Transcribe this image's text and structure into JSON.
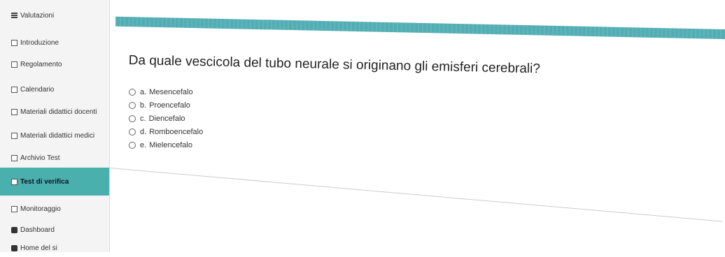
{
  "sidebar": {
    "items": [
      {
        "label": "Valutazioni",
        "icon": "grid-icon",
        "active": false
      },
      {
        "label": "Introduzione",
        "icon": "page-icon",
        "active": false
      },
      {
        "label": "Regolamento",
        "icon": "page-icon",
        "active": false
      },
      {
        "label": "Calendario",
        "icon": "page-icon",
        "active": false
      },
      {
        "label": "Materiali didattici docenti",
        "icon": "page-icon",
        "active": false
      },
      {
        "label": "Materiali didattici medici",
        "icon": "page-icon",
        "active": false
      },
      {
        "label": "Archivio Test",
        "icon": "page-icon",
        "active": false
      },
      {
        "label": "Test di verifica",
        "icon": "page-icon",
        "active": true
      },
      {
        "label": "Monitoraggio",
        "icon": "page-icon",
        "active": false
      },
      {
        "label": "Dashboard",
        "icon": "dashboard-icon",
        "active": false
      },
      {
        "label": "Home del si",
        "icon": "home-icon",
        "active": false
      }
    ]
  },
  "question": {
    "text": "Da quale vescicola del tubo neurale si originano gli emisferi cerebrali?",
    "options": [
      {
        "letter": "a.",
        "label": "Mesencefalo"
      },
      {
        "letter": "b.",
        "label": "Proencefalo"
      },
      {
        "letter": "c.",
        "label": "Diencefalo"
      },
      {
        "letter": "d.",
        "label": "Romboencefalo"
      },
      {
        "letter": "e.",
        "label": "Mielencefalo"
      }
    ]
  },
  "colors": {
    "accent": "#49b0ad",
    "bar": "#52aeb4"
  }
}
